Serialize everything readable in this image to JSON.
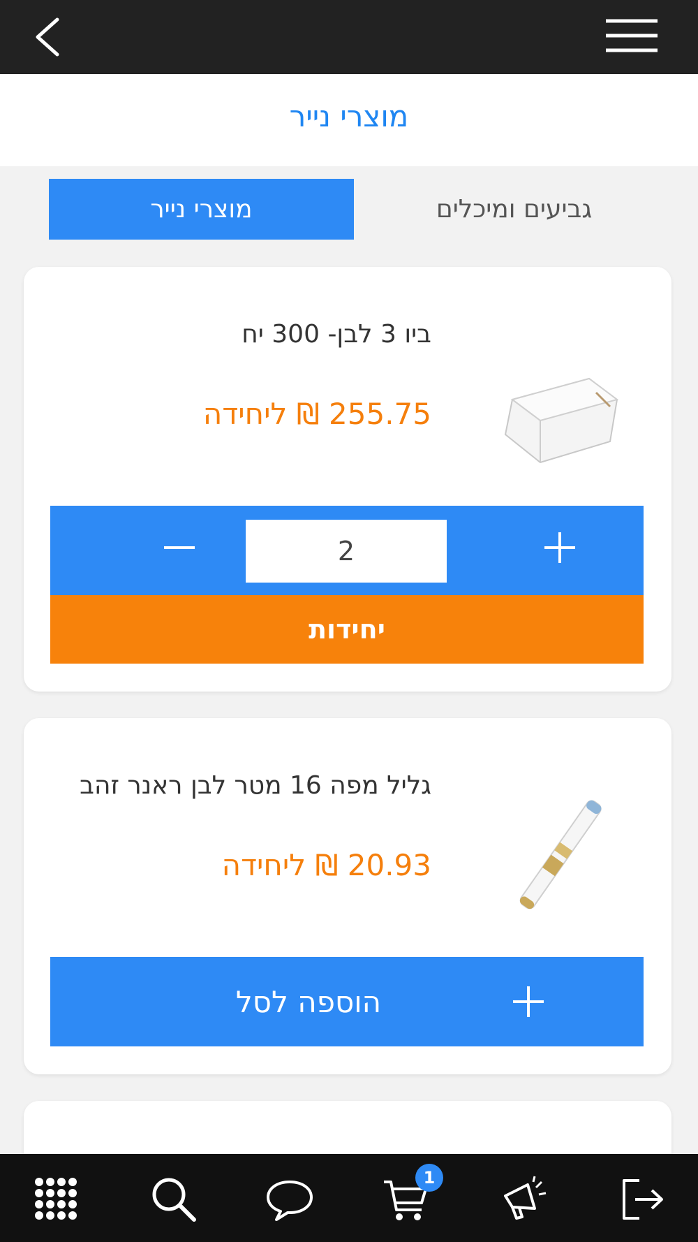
{
  "header": {
    "back_icon": "chevron-left-icon",
    "menu_icon": "hamburger-menu-icon"
  },
  "page": {
    "title": "מוצרי נייר"
  },
  "tabs": [
    {
      "label": "מוצרי נייר",
      "active": true
    },
    {
      "label": "גביעים ומיכלים",
      "active": false
    }
  ],
  "products": [
    {
      "name": "ביו 3 לבן- 300 יח",
      "price": "255.75 ₪ ליחידה",
      "image": "white-takeout-box",
      "quantity": "2",
      "unit_label": "יחידות"
    },
    {
      "name": "גליל מפה 16 מטר לבן ראנר זהב",
      "price": "20.93 ₪ ליחידה",
      "image": "tablecloth-roll",
      "add_label": "הוספה לסל"
    }
  ],
  "bottom_nav": {
    "items": [
      {
        "icon": "grid-icon"
      },
      {
        "icon": "search-icon"
      },
      {
        "icon": "chat-icon"
      },
      {
        "icon": "cart-icon"
      },
      {
        "icon": "megaphone-icon"
      },
      {
        "icon": "logout-icon"
      }
    ],
    "cart_badge": "1"
  },
  "colors": {
    "primary_blue": "#2e8af5",
    "title_blue": "#1f86f2",
    "accent_orange": "#f7820b",
    "topbar": "#222222",
    "bottombar": "#111111"
  }
}
